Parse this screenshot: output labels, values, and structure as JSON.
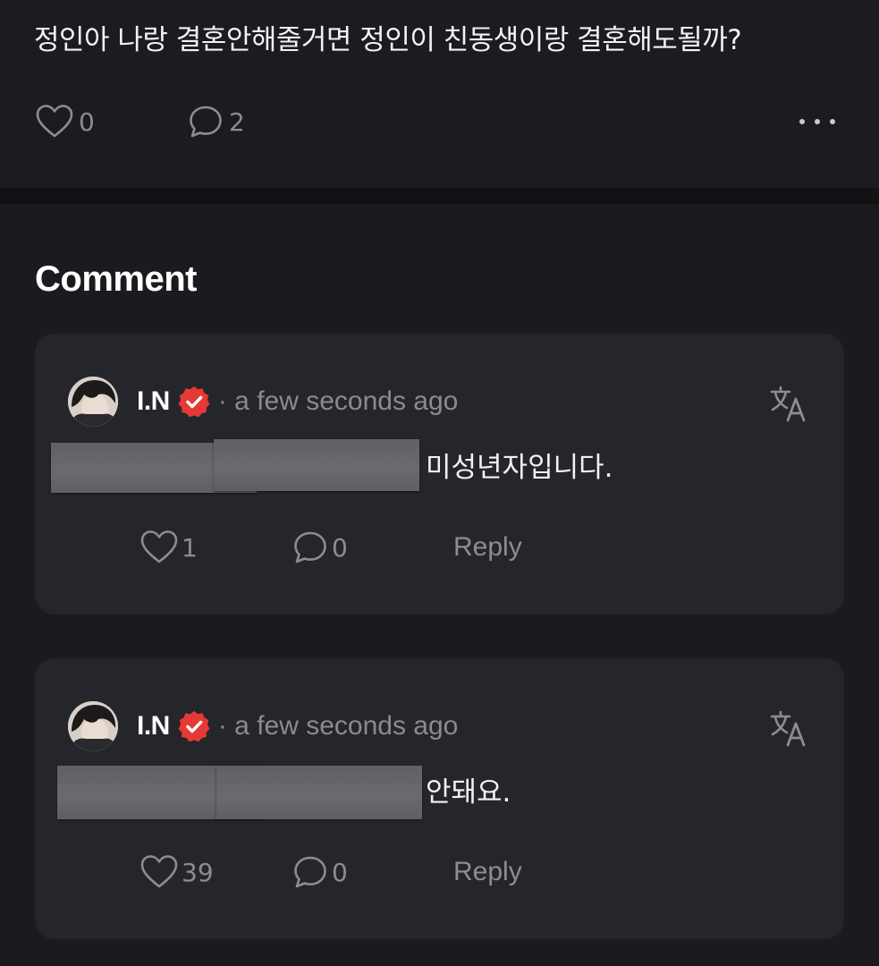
{
  "post": {
    "text": "정인아 나랑 결혼안해줄거면 정인이 친동생이랑 결혼해도될까?",
    "likes": "0",
    "comments": "2",
    "more_icon": "more-horizontal-icon"
  },
  "comments_section": {
    "heading": "Comment",
    "items": [
      {
        "author": "I.N",
        "verified": true,
        "time": "· a few seconds ago",
        "text": "미성년자입니다.",
        "likes": "1",
        "replies": "0",
        "reply_label": "Reply"
      },
      {
        "author": "I.N",
        "verified": true,
        "time": "· a few seconds ago",
        "text": "안돼요.",
        "likes": "39",
        "replies": "0",
        "reply_label": "Reply"
      }
    ]
  },
  "colors": {
    "background": "#1a1a1f",
    "card": "#25252c",
    "muted_text": "#8c8c93",
    "verified_badge": "#e53935",
    "redaction": "#646469"
  }
}
